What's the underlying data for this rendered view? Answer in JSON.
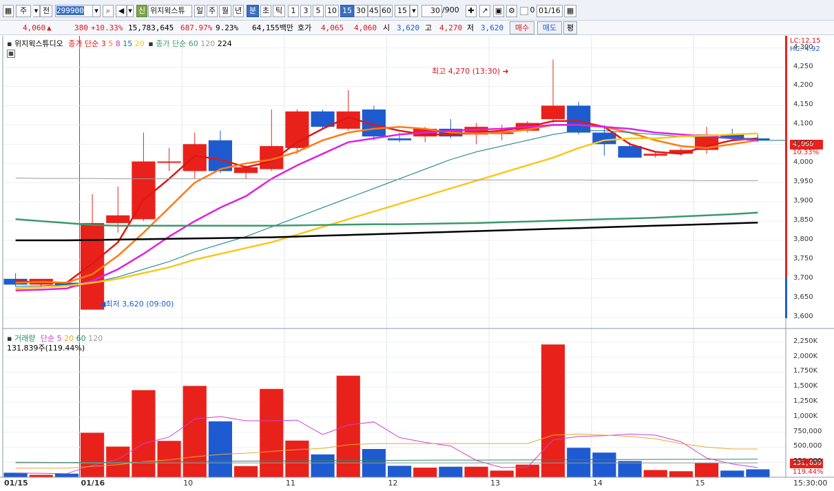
{
  "toolbar": {
    "market_type": "주",
    "prev_label": "전",
    "stock_code": "299900",
    "search_icon": "magnifier-icon",
    "speaker_icon": "speaker-icon",
    "credit_badge": "신",
    "stock_name": "위지윅스튜",
    "period_day": "일",
    "period_week": "주",
    "period_month": "월",
    "period_year": "년",
    "period_minute": "분",
    "period_second": "초",
    "period_tick": "틱",
    "intervals": [
      "1",
      "3",
      "5",
      "10",
      "15",
      "30",
      "45",
      "60"
    ],
    "selected_interval": "15",
    "interval_select": "15",
    "count_value": "30",
    "count_total": "/900",
    "checkbox_label": "0",
    "date_value": "01/16"
  },
  "quote": {
    "price": "4,060",
    "change_arrow": "▲",
    "change": "380",
    "change_rate": "+10.33%",
    "volume": "15,783,645",
    "volume_rate": "687.97%",
    "turnover": "9.23%",
    "amount": "64,155백만",
    "bid_label": "호가",
    "ask_price": "4,065",
    "bid_price": "4,060",
    "open_label": "시",
    "open": "3,620",
    "high_label": "고",
    "high": "4,270",
    "low_label": "저",
    "low": "3,620",
    "buy_button": "매수",
    "sell_button": "매도",
    "eval_button": "평"
  },
  "price_pane": {
    "legend_name": "위지윅스튜디오",
    "legend_ma_title": "종가 단순",
    "legend_ma_short": [
      "3",
      "5",
      "8",
      "15",
      "20"
    ],
    "legend_ma2_title": "종가 단순",
    "legend_ma_long": [
      "60",
      "120",
      "224"
    ],
    "lc_label": "LC:12.15",
    "hc_label": "HC:-4.92",
    "high_annotation": "최고 4,270 (13:30)",
    "low_annotation": "최저 3,620 (09:00)",
    "current_price_tag": "4,060",
    "current_rate_tag": "10.33%",
    "y_ticks": [
      "4,300",
      "4,250",
      "4,200",
      "4,150",
      "4,100",
      "4,050",
      "4,000",
      "3,950",
      "3,900",
      "3,850",
      "3,800",
      "3,750",
      "3,700",
      "3,650",
      "3,600"
    ]
  },
  "volume_pane": {
    "legend_title": "거래량",
    "legend_ma_title": "단순",
    "legend_ma": [
      "5",
      "20",
      "60",
      "120"
    ],
    "current_volume": "131,839주(119.44%)",
    "current_volume_tag": "131,839",
    "current_volume_rate_tag": "119.44%",
    "y_ticks": [
      "2,250K",
      "2,000K",
      "1,750K",
      "1,500K",
      "1,250K",
      "1,000K",
      "750,000",
      "500,000",
      "250,000"
    ]
  },
  "x_axis": {
    "labels": [
      "01/15",
      "01/16",
      "10",
      "11",
      "12",
      "13",
      "14",
      "15"
    ],
    "time_label": "15:30:00"
  },
  "colors": {
    "up": "#e8221b",
    "down": "#1e5bd0",
    "ma3": "#e01616",
    "ma5": "#ff7a10",
    "ma8": "#e020e0",
    "ma15": "#0a7a8a",
    "ma20": "#f7c81c",
    "ma60": "#3a9a6a",
    "ma120": "#9a9a9a",
    "ma224": "#000000"
  },
  "chart_data": {
    "type": "candlestick",
    "price_range": [
      3580,
      4310
    ],
    "volume_range": [
      0,
      2350000
    ],
    "candles": [
      {
        "o": 3700,
        "h": 3715,
        "l": 3680,
        "c": 3685,
        "v": 75000
      },
      {
        "o": 3685,
        "h": 3700,
        "l": 3680,
        "c": 3700,
        "v": 40000
      },
      {
        "o": 3690,
        "h": 3690,
        "l": 3680,
        "c": 3680,
        "v": 60000
      },
      {
        "o": 3620,
        "h": 3920,
        "l": 3620,
        "c": 3845,
        "v": 740000
      },
      {
        "o": 3845,
        "h": 3940,
        "l": 3820,
        "c": 3865,
        "v": 510000
      },
      {
        "o": 3855,
        "h": 4080,
        "l": 3850,
        "c": 4005,
        "v": 1450000
      },
      {
        "o": 4005,
        "h": 4040,
        "l": 3980,
        "c": 4005,
        "v": 605000
      },
      {
        "o": 3980,
        "h": 4080,
        "l": 3960,
        "c": 4050,
        "v": 1520000
      },
      {
        "o": 4060,
        "h": 4085,
        "l": 3975,
        "c": 3980,
        "v": 930000
      },
      {
        "o": 3975,
        "h": 3995,
        "l": 3960,
        "c": 3990,
        "v": 185000
      },
      {
        "o": 3985,
        "h": 4140,
        "l": 3980,
        "c": 4045,
        "v": 1470000
      },
      {
        "o": 4040,
        "h": 4140,
        "l": 4025,
        "c": 4135,
        "v": 610000
      },
      {
        "o": 4135,
        "h": 4140,
        "l": 4090,
        "c": 4095,
        "v": 380000
      },
      {
        "o": 4090,
        "h": 4190,
        "l": 4085,
        "c": 4135,
        "v": 1690000
      },
      {
        "o": 4140,
        "h": 4150,
        "l": 4060,
        "c": 4070,
        "v": 470000
      },
      {
        "o": 4065,
        "h": 4080,
        "l": 4055,
        "c": 4060,
        "v": 190000
      },
      {
        "o": 4070,
        "h": 4095,
        "l": 4055,
        "c": 4090,
        "v": 160000
      },
      {
        "o": 4090,
        "h": 4115,
        "l": 4065,
        "c": 4070,
        "v": 175000
      },
      {
        "o": 4075,
        "h": 4105,
        "l": 4050,
        "c": 4095,
        "v": 175000
      },
      {
        "o": 4080,
        "h": 4100,
        "l": 4060,
        "c": 4080,
        "v": 110000
      },
      {
        "o": 4085,
        "h": 4110,
        "l": 4080,
        "c": 4105,
        "v": 210000
      },
      {
        "o": 4115,
        "h": 4270,
        "l": 4105,
        "c": 4150,
        "v": 2210000
      },
      {
        "o": 4150,
        "h": 4160,
        "l": 4075,
        "c": 4080,
        "v": 490000
      },
      {
        "o": 4080,
        "h": 4100,
        "l": 4020,
        "c": 4050,
        "v": 410000
      },
      {
        "o": 4045,
        "h": 4055,
        "l": 4015,
        "c": 4015,
        "v": 270000
      },
      {
        "o": 4020,
        "h": 4030,
        "l": 4015,
        "c": 4025,
        "v": 120000
      },
      {
        "o": 4025,
        "h": 4040,
        "l": 4020,
        "c": 4035,
        "v": 100000
      },
      {
        "o": 4035,
        "h": 4095,
        "l": 4025,
        "c": 4075,
        "v": 240000
      },
      {
        "o": 4075,
        "h": 4090,
        "l": 4060,
        "c": 4065,
        "v": 110000
      },
      {
        "o": 4065,
        "h": 4075,
        "l": 4055,
        "c": 4060,
        "v": 131839
      }
    ],
    "ma_lines": [
      {
        "name": "3",
        "color": "#e01616",
        "width": 2.5,
        "values": [
          3695,
          3690,
          3690,
          3740,
          3795,
          3905,
          3960,
          4020,
          4010,
          3990,
          4005,
          4055,
          4090,
          4120,
          4100,
          4085,
          4075,
          4075,
          4080,
          4085,
          4095,
          4110,
          4110,
          4095,
          4050,
          4030,
          4025,
          4045,
          4060,
          4065
        ]
      },
      {
        "name": "5",
        "color": "#ff7a10",
        "width": 2.5,
        "values": [
          3690,
          3692,
          3690,
          3712,
          3760,
          3820,
          3885,
          3950,
          3985,
          4000,
          4010,
          4030,
          4060,
          4080,
          4090,
          4095,
          4090,
          4080,
          4078,
          4080,
          4088,
          4100,
          4100,
          4095,
          4080,
          4060,
          4045,
          4040,
          4050,
          4060
        ]
      },
      {
        "name": "8",
        "color": "#e020e0",
        "width": 2.5,
        "values": [
          3670,
          3672,
          3675,
          3695,
          3725,
          3765,
          3810,
          3850,
          3885,
          3915,
          3960,
          3995,
          4025,
          4055,
          4065,
          4075,
          4080,
          4085,
          4088,
          4090,
          4095,
          4100,
          4100,
          4095,
          4090,
          4080,
          4075,
          4070,
          4065,
          4060
        ]
      },
      {
        "name": "15",
        "color": "#0a7a8a",
        "width": 1,
        "values": [
          3680,
          3682,
          3685,
          3690,
          3705,
          3725,
          3745,
          3770,
          3790,
          3810,
          3835,
          3860,
          3885,
          3910,
          3935,
          3960,
          3985,
          4010,
          4030,
          4045,
          4060,
          4075,
          4085,
          4085,
          4080,
          4075,
          4070,
          4068,
          4065,
          4065
        ]
      },
      {
        "name": "20",
        "color": "#f7c81c",
        "width": 2.5,
        "values": [
          3675,
          3678,
          3682,
          3690,
          3700,
          3715,
          3730,
          3750,
          3765,
          3780,
          3795,
          3815,
          3835,
          3855,
          3875,
          3895,
          3915,
          3935,
          3955,
          3975,
          3995,
          4015,
          4040,
          4060,
          4065,
          4065,
          4070,
          4072,
          4075,
          4078
        ]
      },
      {
        "name": "60",
        "color": "#3a9a6a",
        "width": 2.5,
        "values": [
          3855,
          3850,
          3845,
          3840,
          3838,
          3838,
          3838,
          3838,
          3838,
          3838,
          3838,
          3839,
          3840,
          3841,
          3842,
          3842,
          3843,
          3844,
          3845,
          3847,
          3849,
          3851,
          3853,
          3855,
          3857,
          3859,
          3862,
          3865,
          3868,
          3872
        ]
      },
      {
        "name": "120",
        "color": "#9a9a9a",
        "width": 1,
        "values": [
          3962,
          3961,
          3961,
          3961,
          3960,
          3960,
          3960,
          3960,
          3960,
          3960,
          3959,
          3959,
          3959,
          3959,
          3958,
          3958,
          3958,
          3958,
          3957,
          3957,
          3957,
          3957,
          3957,
          3956,
          3956,
          3956,
          3956,
          3955,
          3955,
          3955
        ]
      },
      {
        "name": "224",
        "color": "#000000",
        "width": 2.5,
        "values": [
          3800,
          3800,
          3800,
          3801,
          3802,
          3803,
          3804,
          3805,
          3806,
          3807,
          3808,
          3810,
          3812,
          3814,
          3816,
          3818,
          3820,
          3822,
          3824,
          3826,
          3828,
          3830,
          3832,
          3834,
          3836,
          3838,
          3840,
          3842,
          3844,
          3846
        ]
      }
    ],
    "vol_ma_lines": [
      {
        "name": "5",
        "color": "#d040c8",
        "values": [
          70000,
          65000,
          60000,
          200000,
          300000,
          560000,
          670000,
          970000,
          1010000,
          940000,
          940000,
          950000,
          710000,
          870000,
          920000,
          660000,
          580000,
          520000,
          280000,
          160000,
          170000,
          620000,
          680000,
          690000,
          720000,
          700000,
          590000,
          320000,
          220000,
          160000
        ]
      },
      {
        "name": "20",
        "color": "#e8a830",
        "values": [
          150000,
          150000,
          150000,
          180000,
          210000,
          260000,
          290000,
          340000,
          380000,
          400000,
          430000,
          460000,
          480000,
          540000,
          560000,
          560000,
          560000,
          560000,
          560000,
          560000,
          560000,
          700000,
          720000,
          700000,
          680000,
          640000,
          560000,
          500000,
          470000,
          470000
        ]
      },
      {
        "name": "60",
        "color": "#2a8a6a",
        "values": [
          250000,
          248000,
          245000,
          248000,
          250000,
          255000,
          258000,
          262000,
          265000,
          268000,
          270000,
          272000,
          275000,
          278000,
          280000,
          282000,
          284000,
          285000,
          286000,
          287000,
          288000,
          290000,
          292000,
          294000,
          296000,
          297000,
          298000,
          298000,
          299000,
          300000
        ]
      },
      {
        "name": "120",
        "color": "#9a9a9a",
        "values": [
          240000,
          240000,
          239000,
          239000,
          238000,
          238000,
          238000,
          238000,
          238000,
          238000,
          238000,
          238000,
          238000,
          238000,
          238000,
          238000,
          238000,
          238000,
          238000,
          238000,
          238000,
          238000,
          238000,
          238000,
          238000,
          238000,
          238000,
          238000,
          238000,
          238000
        ]
      }
    ]
  }
}
